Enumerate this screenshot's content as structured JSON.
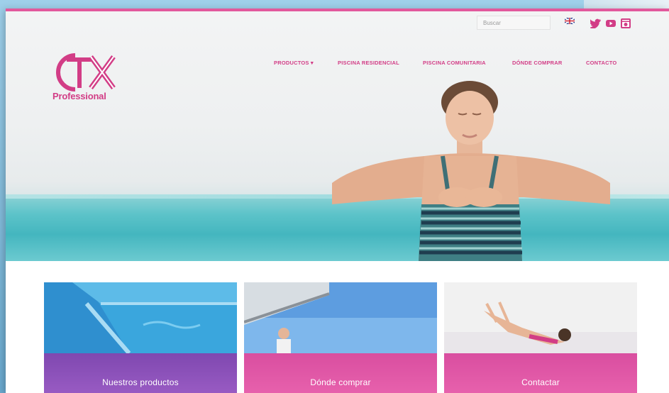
{
  "brand": {
    "logo_text": "CTX",
    "logo_sub": "Professional"
  },
  "header": {
    "search_placeholder": "Buscar",
    "language_flag": "uk-flag-icon",
    "social": [
      "twitter-icon",
      "youtube-icon",
      "instagram-icon"
    ]
  },
  "nav": {
    "items": [
      {
        "label": "PRODUCTOS ▾"
      },
      {
        "label": "PISCINA RESIDENCIAL"
      },
      {
        "label": "PISCINA COMUNITARIA"
      },
      {
        "label": "DÓNDE COMPRAR"
      },
      {
        "label": "CONTACTO"
      }
    ]
  },
  "tiles": [
    {
      "label": "Nuestros productos",
      "bar_color": "#8a55b8"
    },
    {
      "label": "Dónde comprar",
      "bar_color": "#e05aa6"
    },
    {
      "label": "Contactar",
      "bar_color": "#e05aa6"
    }
  ],
  "colors": {
    "accent": "#d23d86",
    "topline": "#e2599c"
  }
}
